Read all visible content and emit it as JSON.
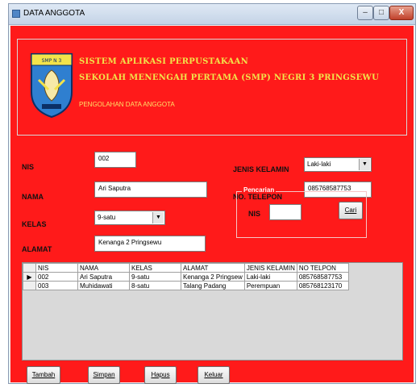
{
  "window": {
    "title": "DATA ANGGOTA",
    "min_icon": "minimize-icon",
    "max_icon": "maximize-icon",
    "close_icon": "close-icon",
    "close_glyph": "X"
  },
  "header": {
    "logo_icon": "school-emblem-logo",
    "line1": "SISTEM APLIKASI PERPUSTAKAAN",
    "line2": "SEKOLAH MENENGAH PERTAMA (SMP) NEGRI 3 PRINGSEWU",
    "line3": "PENGOLAHAN DATA ANGGOTA"
  },
  "form": {
    "nis_label": "NIS",
    "nis_value": "002",
    "nama_label": "NAMA",
    "nama_value": "Ari Saputra",
    "kelas_label": "KELAS",
    "kelas_value": "9-satu",
    "alamat_label": "ALAMAT",
    "alamat_value": "Kenanga 2 Pringsewu",
    "jk_label": "JENIS KELAMIN",
    "jk_value": "Laki-laki",
    "telp_label": "NO. TELEPON",
    "telp_value": "085768587753"
  },
  "search": {
    "group_title": "Pencarian",
    "nis_label": "NIS",
    "nis_value": "",
    "cari_label": "Cari"
  },
  "table": {
    "columns": [
      "NIS",
      "NAMA",
      "KELAS",
      "ALAMAT",
      "JENIS KELAMIN",
      "NO TELPON"
    ],
    "rows": [
      [
        "002",
        "Ari Saputra",
        "9-satu",
        "Kenanga 2 Pringsew",
        "Laki-laki",
        "085768587753"
      ],
      [
        "003",
        "Muhidawati",
        "8-satu",
        "Talang Padang",
        "Perempuan",
        "085768123170"
      ]
    ]
  },
  "buttons": {
    "tambah": "Tambah",
    "simpan": "Simpan",
    "hapus": "Hapus",
    "keluar": "Keluar"
  },
  "colors": {
    "background": "#ff1a1a",
    "title_text": "#f2e24a",
    "subtitle_text": "#ffe066"
  }
}
